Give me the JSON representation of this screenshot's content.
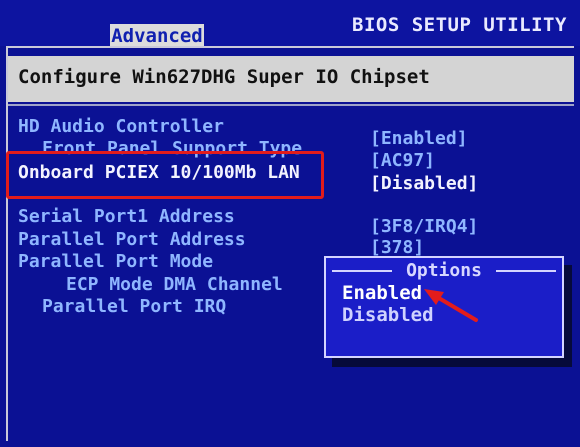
{
  "header": {
    "title": "BIOS SETUP UTILITY",
    "active_tab": "Advanced"
  },
  "section": {
    "title": "Configure Win627DHG Super IO Chipset"
  },
  "settings": [
    {
      "label": "HD Audio Controller",
      "value": "[Enabled]"
    },
    {
      "label": "Front Panel Support Type",
      "value": "[AC97]"
    },
    {
      "label": "Onboard PCIEX 10/100Mb LAN",
      "value": "[Disabled]"
    },
    {
      "label": "Serial Port1 Address",
      "value": "[3F8/IRQ4]"
    },
    {
      "label": "Parallel Port Address",
      "value": "[378]"
    },
    {
      "label": "Parallel Port Mode",
      "value": ""
    },
    {
      "label": "ECP Mode DMA Channel",
      "value": ""
    },
    {
      "label": "Parallel Port IRQ",
      "value": ""
    }
  ],
  "options_popup": {
    "title": "Options",
    "items": [
      "Enabled",
      "Disabled"
    ],
    "selected": "Enabled"
  },
  "colors": {
    "background": "#0b1194",
    "highlight_box": "#e31c1c",
    "annotation_arrow": "#e31c1c",
    "popup": "#1b1ec8"
  },
  "icons": {
    "annotation": "red-arrow-icon"
  }
}
